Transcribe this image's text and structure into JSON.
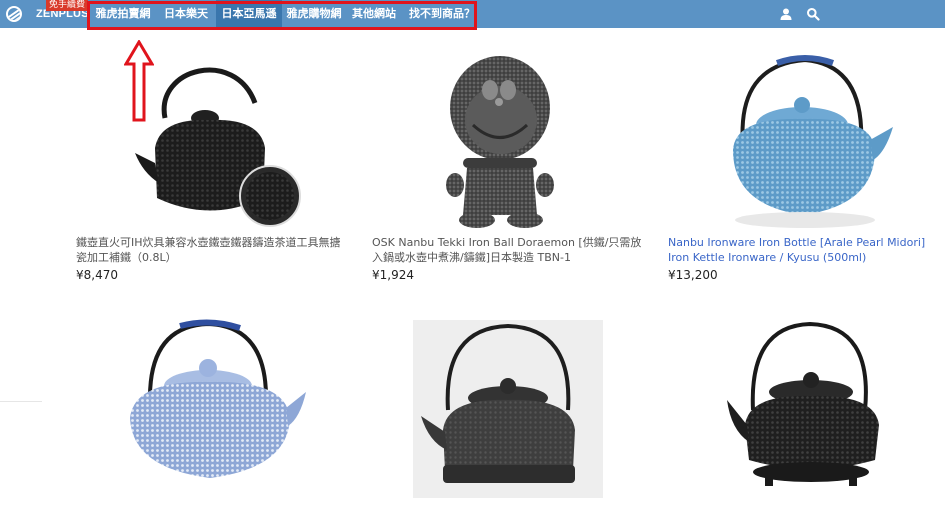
{
  "header": {
    "brand": "ZENPLUS",
    "badge": "免手續費",
    "nav": [
      {
        "label": "雅虎拍賣網",
        "active": false
      },
      {
        "label": "日本樂天",
        "active": false
      },
      {
        "label": "日本亞馬遜",
        "active": true
      },
      {
        "label": "雅虎購物網",
        "active": false
      },
      {
        "label": "其他網站",
        "active": false
      },
      {
        "label": "找不到商品？",
        "active": false
      }
    ],
    "icons": [
      "user-icon",
      "search-icon"
    ]
  },
  "colors": {
    "topbar": "#5b93c5",
    "active_tab": "#3a76ad",
    "highlight": "#e0141c",
    "link": "#3a66c8"
  },
  "products": [
    {
      "title": "鐵壺直火可IH炊具兼容水壺鐵壺鐵器鑄造茶道工具無搪瓷加工補鐵（0.8L）",
      "price": "¥8,470"
    },
    {
      "title": "OSK Nanbu Tekki Iron Ball Doraemon [供鐵/只需放入鍋或水壺中煮沸/鑄鐵]日本製造 TBN-1",
      "price": "¥1,924"
    },
    {
      "title": "Nanbu Ironware Iron Bottle [Arale Pearl Midori] Iron Kettle Ironware / Kyusu (500ml)",
      "price": "¥13,200"
    },
    {
      "title": "",
      "price": ""
    },
    {
      "title": "",
      "price": ""
    },
    {
      "title": "",
      "price": ""
    }
  ]
}
